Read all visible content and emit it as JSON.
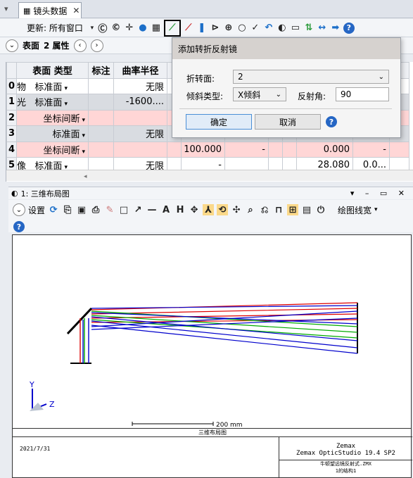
{
  "tab": {
    "title": "镜头数据",
    "close": "✕"
  },
  "toolbar": {
    "update_label": "更新: 所有窗口"
  },
  "bar2": {
    "surface_label": "表面",
    "properties_label": "2 属性"
  },
  "table": {
    "headers": [
      "",
      "表面 类型",
      "标注",
      "曲率半径"
    ],
    "rows": [
      {
        "num": "0",
        "name": "物",
        "type": "标准面",
        "radius": "无限",
        "style": "normal",
        "c5": "",
        "c6": "",
        "c7": ""
      },
      {
        "num": "1",
        "name": "光",
        "type": "标准面",
        "radius": "-1600....",
        "style": "normal",
        "c5": "",
        "c6": "",
        "c7": ""
      },
      {
        "num": "2",
        "name": "",
        "type": "坐标间断",
        "radius": "",
        "style": "pink",
        "c5": "",
        "c6": "",
        "c7": ""
      },
      {
        "num": "3",
        "name": "",
        "type": "标准面",
        "radius": "无限",
        "style": "grey",
        "c5": "",
        "c6": "",
        "c7": ""
      },
      {
        "num": "4",
        "name": "",
        "type": "坐标间断",
        "radius": "",
        "style": "pink",
        "c5": "100.000",
        "c6": "-",
        "c7": "0.000",
        "c8": "-"
      },
      {
        "num": "5",
        "name": "像",
        "type": "标准面",
        "radius": "无限",
        "style": "normal",
        "c5": "-",
        "c6": "",
        "c7": "28.080",
        "c8": "0.0..."
      }
    ]
  },
  "dialog": {
    "title": "添加转折反射镜",
    "fold_label": "折转面:",
    "fold_value": "2",
    "tilt_label": "倾斜类型:",
    "tilt_value": "X倾斜",
    "reflect_label": "反射角:",
    "reflect_value": "90",
    "ok_label": "确定",
    "cancel_label": "取消"
  },
  "layout": {
    "title": "1: 三维布局图",
    "settings_label": "设置",
    "line_width_label": "绘图线宽",
    "scale_label": "200 mm",
    "plot_caption": "三维布局图",
    "date": "2021/7/31",
    "brand": "Zemax",
    "product": "Zemax OpticStudio 19.4 SP2",
    "file_label": "牛顿望远镜反射式.ZMX",
    "config_label": "1的结构1",
    "axis_y": "Y",
    "axis_z": "Z"
  },
  "colors": {
    "pink_row": "#ffd6d6",
    "grey_row": "#d9dce1",
    "accent": "#2566c4"
  }
}
